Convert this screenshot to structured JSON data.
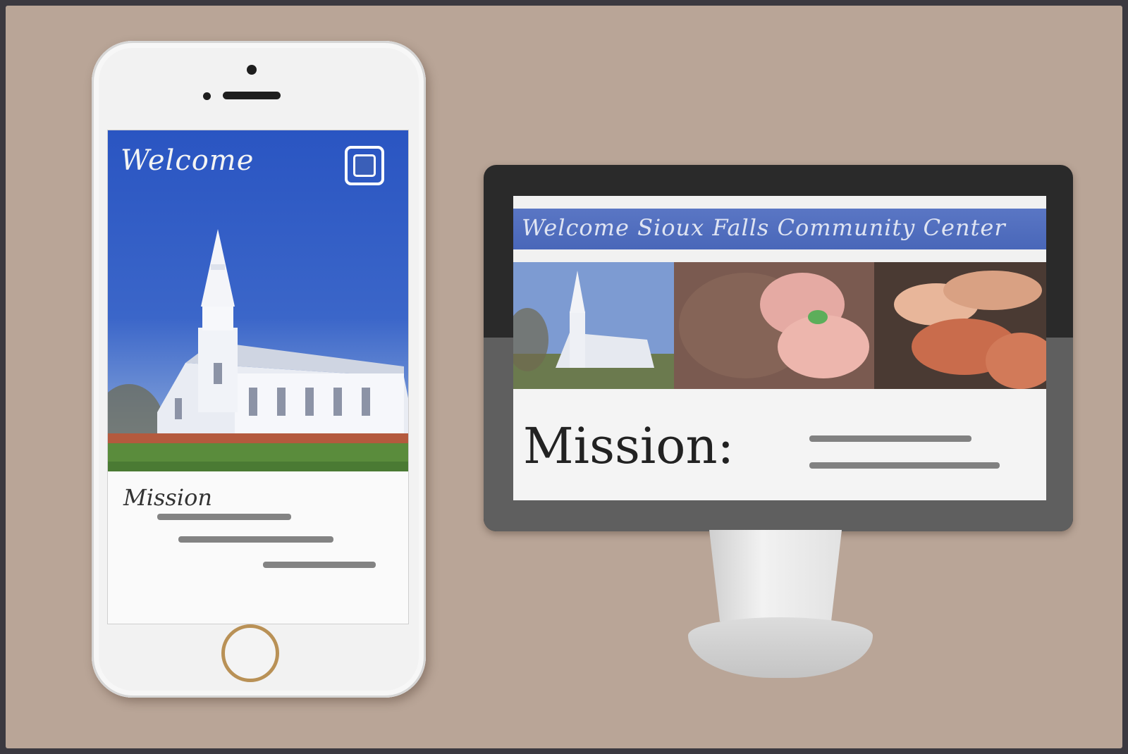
{
  "mobile": {
    "header_title": "Welcome",
    "menu_icon": "menu-icon",
    "text_heading": "Mission"
  },
  "desktop": {
    "header_title": "Welcome Sioux Falls Community Center",
    "mission_heading": "Mission:"
  },
  "colors": {
    "brand_blue": "#3a5fb8",
    "background": "#b9a597",
    "home_button_ring": "#b99156"
  }
}
